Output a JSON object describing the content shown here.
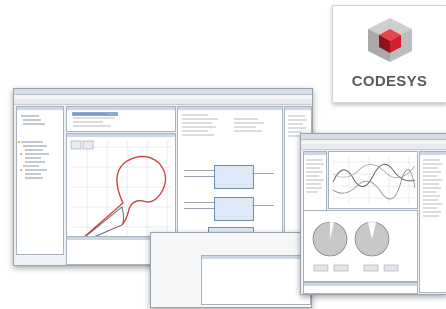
{
  "brand": {
    "name": "CODESYS",
    "colors": {
      "cube_red": "#d0202a",
      "cube_grey": "#b3b3b3",
      "text": "#5a5a5a"
    }
  },
  "windows": [
    {
      "id": "cam-editor",
      "content": [
        "device-tree",
        "cam-profile-graph",
        "fbd-editor",
        "message-panel"
      ]
    },
    {
      "id": "trace-visualization",
      "content": [
        "property-panel",
        "trace-curves",
        "pie-gauges",
        "buttons",
        "symbol-list"
      ]
    }
  ],
  "curve_colors": {
    "cam_profile": "#d63a3a",
    "cam_path": "#6a6a6a",
    "trace_line": "#5a5a5a",
    "gauge_fill": "#c8c8c8"
  }
}
